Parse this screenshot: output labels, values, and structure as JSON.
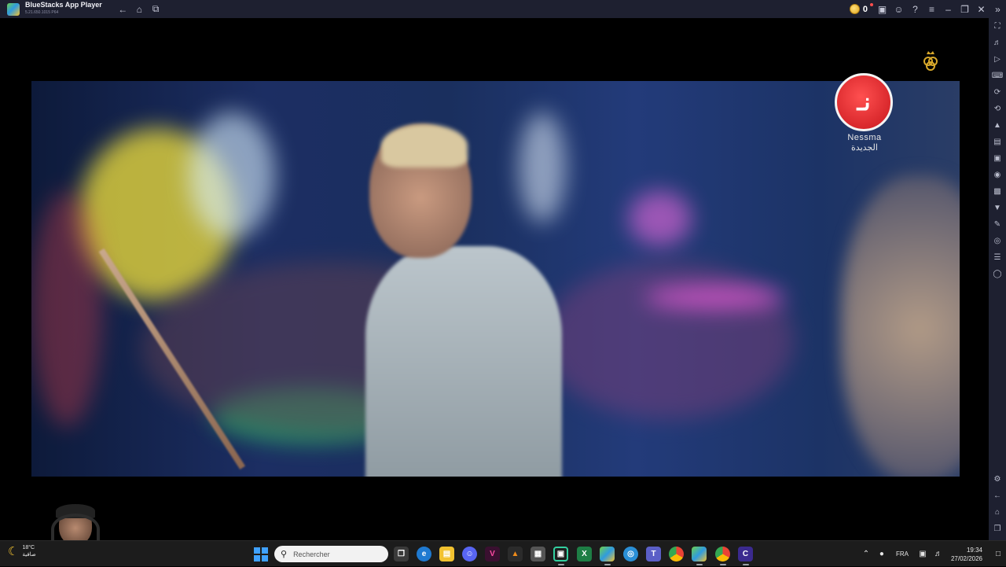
{
  "window": {
    "title": "BlueStacks App Player",
    "version": "5.21.650.1015 P64",
    "coins": "0"
  },
  "video": {
    "channel_name": "Nessma",
    "channel_name_ar": "الجديدة",
    "logo_glyph": "نـ"
  },
  "taskbar": {
    "weather_temp": "18°C",
    "weather_desc": "صافية",
    "search_placeholder": "Rechercher",
    "language": "FRA",
    "time": "19:34",
    "date": "27/02/2026"
  },
  "colors": {
    "titlebar_bg": "#1e2030",
    "taskbar_bg": "#1c1c1c",
    "accent": "#3fa1ff"
  }
}
